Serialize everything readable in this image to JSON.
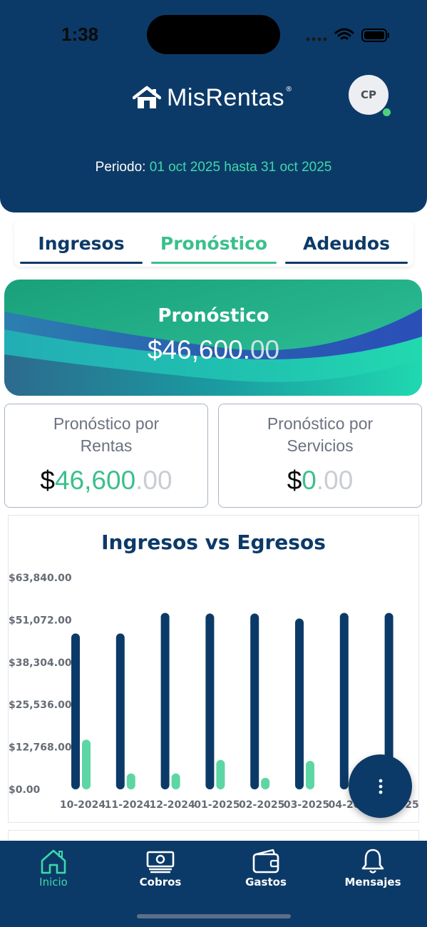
{
  "status": {
    "time": "1:38"
  },
  "header": {
    "brand": "MisRentas",
    "brand_mark": "®",
    "avatar_initials": "CP",
    "period_label": "Periodo:",
    "period_range": "01 oct 2025 hasta 31 oct 2025"
  },
  "tabs": [
    {
      "label": "Ingresos",
      "active": false
    },
    {
      "label": "Pronóstico",
      "active": true
    },
    {
      "label": "Adeudos",
      "active": false
    }
  ],
  "banner": {
    "title": "Pronóstico",
    "amount_main": "$46,600.",
    "amount_cents": "00"
  },
  "cards": [
    {
      "title": "Pronóstico por Rentas",
      "dollar": "$",
      "whole": "46,600",
      "cents": ".00"
    },
    {
      "title": "Pronóstico por Servicios",
      "dollar": "$",
      "whole": "0",
      "cents": ".00"
    }
  ],
  "chart": {
    "title": "Ingresos vs Egresos"
  },
  "chart_data": {
    "type": "bar",
    "title": "Ingresos vs Egresos",
    "categories": [
      "10-2024",
      "11-2024",
      "12-2024",
      "01-2025",
      "02-2025",
      "03-2025",
      "04-2025",
      "05-2025"
    ],
    "tick_labels": [
      "$63,840.00",
      "$51,072.00",
      "$38,304.00",
      "$25,536.00",
      "$12,768.00",
      "$0.00"
    ],
    "ylim": [
      0,
      63840
    ],
    "series": [
      {
        "values": [
          47000,
          47000,
          53200,
          53000,
          53000,
          51500,
          53200,
          53200
        ],
        "color": "#0c3a68"
      },
      {
        "values": [
          15000,
          4800,
          4800,
          8900,
          3500,
          8600,
          0,
          0
        ],
        "color": "#5dd6a4"
      }
    ],
    "grid": false,
    "legend": "none"
  },
  "nav": [
    {
      "label": "Inicio",
      "icon": "home-icon",
      "active": true
    },
    {
      "label": "Cobros",
      "icon": "money-icon",
      "active": false
    },
    {
      "label": "Gastos",
      "icon": "wallet-icon",
      "active": false
    },
    {
      "label": "Mensajes",
      "icon": "bell-icon",
      "active": false
    }
  ],
  "colors": {
    "primary": "#0c3a68",
    "accent": "#3bbf8c",
    "accent_light": "#3ed9a8"
  }
}
